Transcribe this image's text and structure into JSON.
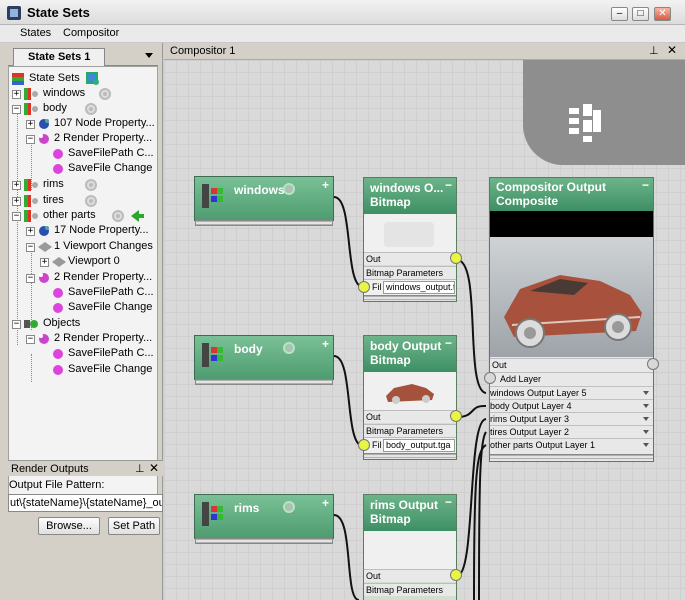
{
  "window": {
    "title": "State Sets",
    "btn_min": "–",
    "btn_max": "□",
    "btn_close": "✕"
  },
  "menu": {
    "items": [
      "States",
      "Compositor"
    ]
  },
  "left": {
    "tab": "State Sets 1",
    "tree": [
      {
        "label": "State Sets"
      },
      {
        "label": "windows"
      },
      {
        "label": "body"
      },
      {
        "label": "107 Node Property..."
      },
      {
        "label": "2 Render Property..."
      },
      {
        "label": "SaveFilePath C..."
      },
      {
        "label": "SaveFile Change"
      },
      {
        "label": "rims"
      },
      {
        "label": "tires"
      },
      {
        "label": "other parts"
      },
      {
        "label": "17 Node Property..."
      },
      {
        "label": "1 Viewport Changes"
      },
      {
        "label": "Viewport 0"
      },
      {
        "label": "2 Render Property..."
      },
      {
        "label": "SaveFilePath C..."
      },
      {
        "label": "SaveFile Change"
      },
      {
        "label": "Objects"
      },
      {
        "label": "2 Render Property..."
      },
      {
        "label": "SaveFilePath C..."
      },
      {
        "label": "SaveFile Change"
      }
    ],
    "render_outputs": {
      "title": "Render Outputs",
      "pattern_label": "Output File Pattern:",
      "pattern_value": "ut\\{stateName}\\{stateName}_output",
      "browse": "Browse...",
      "set_path": "Set Path"
    }
  },
  "compositor": {
    "title": "Compositor 1",
    "state_nodes": [
      "windows",
      "body",
      "rims"
    ],
    "bitmap_nodes": [
      {
        "title": "windows O... Bitmap",
        "out": "Out",
        "params": "Bitmap Parameters",
        "file_label": "Fil",
        "file": "windows_output.tg"
      },
      {
        "title": "body Output Bitmap",
        "out": "Out",
        "params": "Bitmap Parameters",
        "file_label": "Fil",
        "file": "body_output.tga"
      },
      {
        "title": "rims Output Bitmap",
        "out": "Out",
        "params": "Bitmap Parameters"
      }
    ],
    "composite": {
      "title_line1": "Compositor Output",
      "title_line2": "Composite",
      "out": "Out",
      "add_layer": "Add Layer",
      "layers": [
        "windows Output Layer 5",
        "body Output Layer 4",
        "rims Output Layer 3",
        "tires Output Layer 2",
        "other parts Output Layer 1"
      ]
    }
  }
}
